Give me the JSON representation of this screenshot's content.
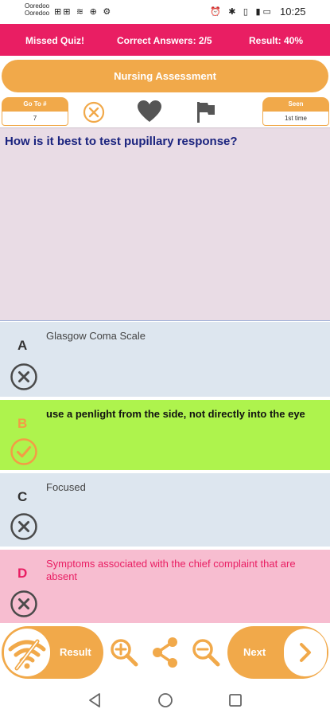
{
  "status_bar": {
    "carrier_line1": "Ooredoo",
    "carrier_line2": "Ooredoo",
    "left_icons": "⊞⊞ ≋ ⊕ ⚙",
    "right_icons": "⏰ ✱ ▯ ▮▭",
    "time": "10:25"
  },
  "top_bar": {
    "missed_label": "Missed Quiz!",
    "correct_label": "Correct Answers: 2/5",
    "result_label": "Result: 40%"
  },
  "title": "Nursing Assessment",
  "toolbar": {
    "goto_label": "Go To #",
    "goto_value": "7",
    "seen_label": "Seen",
    "seen_value": "1st time",
    "icons": [
      "close-circle-icon",
      "heart-icon",
      "flag-icon"
    ]
  },
  "question": {
    "text": "How is it best to test pupillary response?"
  },
  "answers": [
    {
      "letter": "A",
      "text": "Glasgow Coma Scale",
      "status": "wrong"
    },
    {
      "letter": "B",
      "text": "use a penlight from the side, not directly into the eye",
      "status": "correct"
    },
    {
      "letter": "C",
      "text": "Focused",
      "status": "wrong"
    },
    {
      "letter": "D",
      "text": "Symptoms associated with the chief complaint that are absent",
      "status": "wrong"
    }
  ],
  "bottom_bar": {
    "result_label": "Result",
    "next_label": "Next",
    "icons": [
      "wifi-off-icon",
      "zoom-in-icon",
      "share-icon",
      "zoom-out-icon",
      "chevron-right-icon"
    ]
  },
  "colors": {
    "accent_pink": "#e91e63",
    "accent_orange": "#f1a94a",
    "correct_green": "#aef34d",
    "question_bg": "#e9dce5",
    "neutral_answer_bg": "#dde6ef",
    "wrong_pink_bg": "#f7bdd0"
  }
}
